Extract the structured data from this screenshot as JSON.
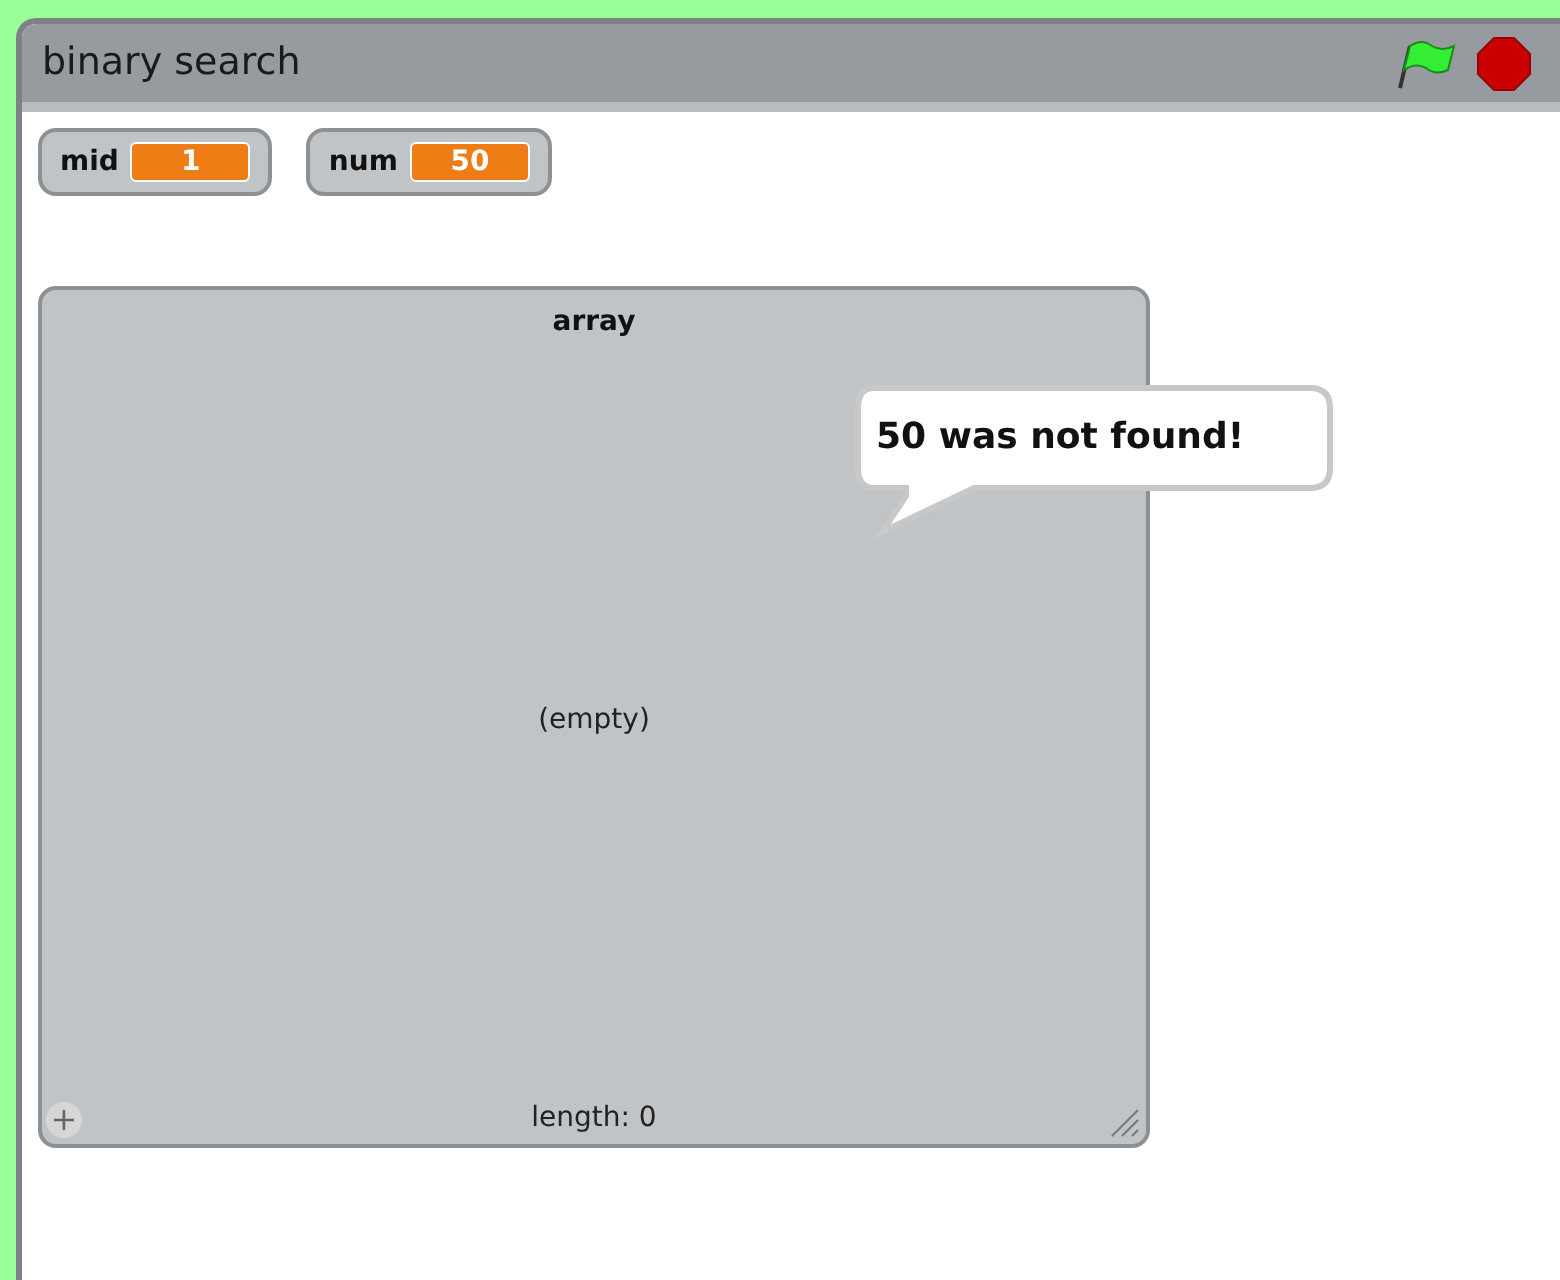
{
  "window": {
    "title": "binary search"
  },
  "variables": [
    {
      "name": "mid",
      "value": "1"
    },
    {
      "name": "num",
      "value": "50"
    }
  ],
  "list": {
    "title": "array",
    "empty_text": "(empty)",
    "length": "length: 0",
    "add_button": "+"
  },
  "speech_bubble": {
    "text": "50 was not found!"
  }
}
